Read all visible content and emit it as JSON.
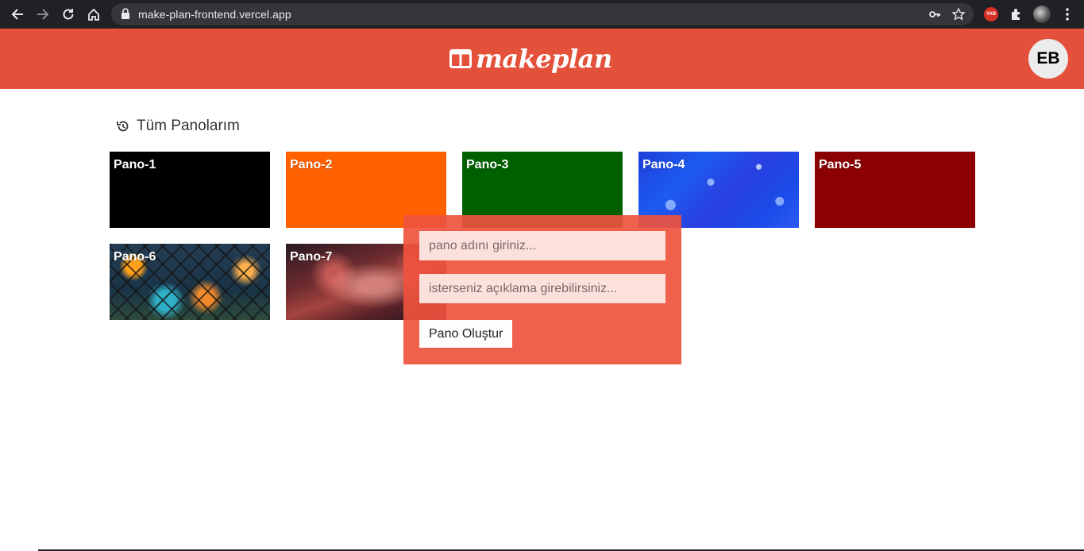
{
  "browser": {
    "url": "make-plan-frontend.vercel.app",
    "extension_badge": "YAB"
  },
  "header": {
    "brand": "makeplan",
    "avatar_initials": "EB",
    "brand_color": "#e4513a"
  },
  "section": {
    "title": "Tüm Panolarım"
  },
  "boards": [
    {
      "label": "Pano-1",
      "color": "#000000"
    },
    {
      "label": "Pano-2",
      "color": "#ff6000"
    },
    {
      "label": "Pano-3",
      "color": "#006000"
    },
    {
      "label": "Pano-4",
      "background": "blue-image"
    },
    {
      "label": "Pano-5",
      "color": "#8b0000"
    },
    {
      "label": "Pano-6",
      "background": "fence-bokeh-image"
    },
    {
      "label": "Pano-7",
      "background": "galaxy-image"
    }
  ],
  "create_form": {
    "name_placeholder": "pano adını giriniz...",
    "description_placeholder": "isterseniz açıklama girebilirsiniz...",
    "submit_label": "Pano Oluştur"
  }
}
